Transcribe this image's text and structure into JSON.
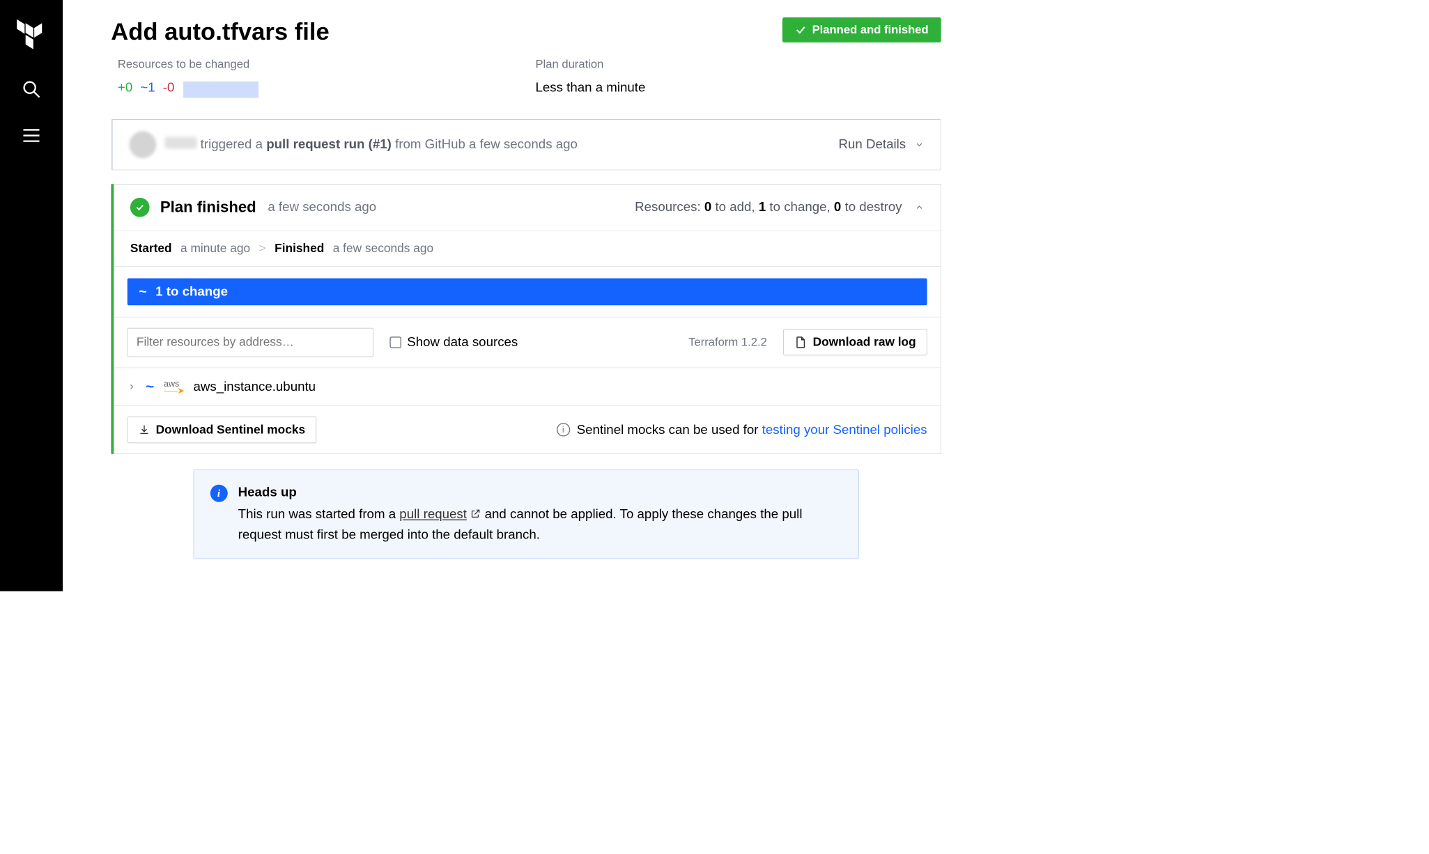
{
  "page": {
    "title": "Add auto.tfvars file"
  },
  "status_badge": "Planned and finished",
  "meta": {
    "resources_label": "Resources to be changed",
    "add": "+0",
    "change": "~1",
    "destroy": "-0",
    "duration_label": "Plan duration",
    "duration_value": "Less than a minute"
  },
  "trigger": {
    "action_prefix": "triggered a ",
    "action_bold": "pull request run (#1)",
    "action_suffix": " from GitHub a few seconds ago",
    "details_label": "Run Details"
  },
  "plan": {
    "title": "Plan finished",
    "time": "a few seconds ago",
    "summary_parts": [
      "Resources: ",
      "0",
      " to add, ",
      "1",
      " to change, ",
      "0",
      " to destroy"
    ]
  },
  "timeline": {
    "started_label": "Started",
    "started_value": "a minute ago",
    "finished_label": "Finished",
    "finished_value": "a few seconds ago"
  },
  "change_banner": "1 to change",
  "filter": {
    "placeholder": "Filter resources by address…",
    "data_sources_label": "Show data sources",
    "tf_version": "Terraform 1.2.2",
    "download_log": "Download raw log"
  },
  "resource": {
    "name": "aws_instance.ubuntu"
  },
  "sentinel": {
    "button": "Download Sentinel mocks",
    "text": "Sentinel mocks can be used for ",
    "link": "testing your Sentinel policies"
  },
  "heads_up": {
    "title": "Heads up",
    "body_prefix": "This run was started from a ",
    "body_link": "pull request",
    "body_suffix": " and cannot be applied. To apply these changes the pull request must first be merged into the default branch."
  }
}
